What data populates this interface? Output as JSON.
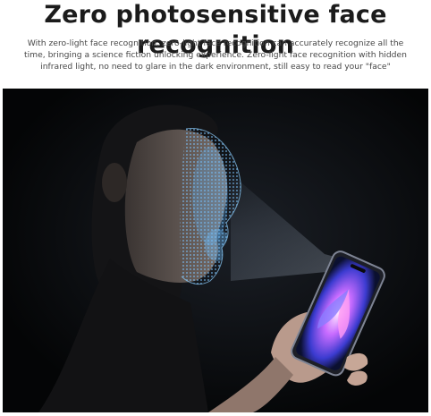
{
  "headline": "Zero photosensitive face recognition",
  "description": "With zero-light face recognition, zero-light face recognition can accurately recognize all the time, bringing a science fiction unlocking experience. Zero-light face recognition with hidden infrared light, no need to glare in the dark environment, still easy to read your \"face\"",
  "photo": {
    "subject": "person-face-scan-with-phone-icon",
    "background_color": "#050608",
    "scan_color": "#4aa8ff",
    "screen_glow_color": "#c86cff"
  }
}
